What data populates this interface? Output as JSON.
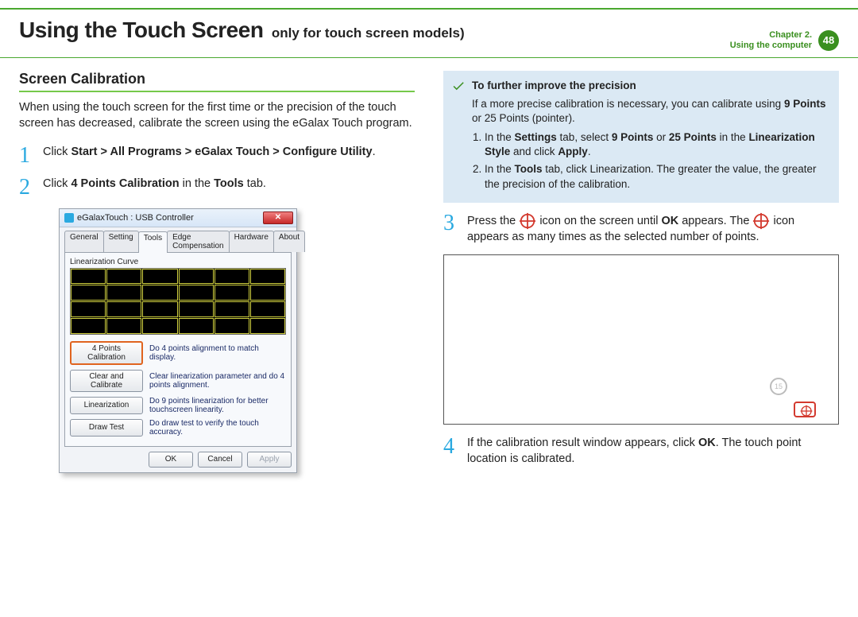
{
  "header": {
    "title_main": "Using the Touch Screen",
    "title_sub": "only for touch screen models)",
    "chapter_line1": "Chapter 2.",
    "chapter_line2": "Using the computer",
    "page_number": "48"
  },
  "left": {
    "section_heading": "Screen Calibration",
    "intro": "When using the touch screen for the first time or the precision of the touch screen has decreased, calibrate the screen using the eGalax Touch program.",
    "step1_pre": "Click ",
    "step1_bold": "Start > All Programs > eGalax Touch > Configure Utility",
    "step1_post": ".",
    "step2_pre": "Click ",
    "step2_bold": "4 Points Calibration",
    "step2_mid": " in the ",
    "step2_bold2": "Tools",
    "step2_post": " tab."
  },
  "dialog": {
    "title": "eGalaxTouch : USB Controller",
    "tabs": [
      "General",
      "Setting",
      "Tools",
      "Edge Compensation",
      "Hardware",
      "About"
    ],
    "active_tab_index": 2,
    "group_label": "Linearization Curve",
    "rows": [
      {
        "btn": "4 Points Calibration",
        "desc": "Do 4 points alignment to match display.",
        "hi": true
      },
      {
        "btn": "Clear and Calibrate",
        "desc": "Clear linearization parameter and do 4 points alignment.",
        "hi": false
      },
      {
        "btn": "Linearization",
        "desc": "Do 9 points linearization for better touchscreen linearity.",
        "hi": false
      },
      {
        "btn": "Draw Test",
        "desc": "Do draw test to verify the touch accuracy.",
        "hi": false
      }
    ],
    "bottom_buttons": {
      "ok": "OK",
      "cancel": "Cancel",
      "apply": "Apply"
    }
  },
  "right": {
    "note_title": "To further improve the precision",
    "note_body": "If a more precise calibration is necessary, you can calibrate using ",
    "note_body_bold": "9 Points",
    "note_body_tail": " or 25 Points (pointer).",
    "note_li1_pre": "In the ",
    "note_li1_b1": "Settings",
    "note_li1_mid1": " tab, select ",
    "note_li1_b2": "9 Points",
    "note_li1_mid2": " or ",
    "note_li1_b3": "25 Points",
    "note_li1_mid3": " in the ",
    "note_li1_b4": "Linearization Style",
    "note_li1_mid4": " and click ",
    "note_li1_b5": "Apply",
    "note_li1_tail": ".",
    "note_li2_pre": "In the ",
    "note_li2_b1": "Tools",
    "note_li2_tail": " tab, click Linearization. The greater the value, the greater the precision of the calibration.",
    "step3_pre": "Press the ",
    "step3_mid": " icon on the screen until ",
    "step3_bold": "OK",
    "step3_mid2": " appears. The ",
    "step3_tail": " icon appears as many times as the selected number of points.",
    "gray_badge": "15",
    "step4_pre": "If the calibration result window appears, click ",
    "step4_bold": "OK",
    "step4_tail": ". The touch point location is calibrated."
  },
  "step_numbers": {
    "s1": "1",
    "s2": "2",
    "s3": "3",
    "s4": "4"
  }
}
